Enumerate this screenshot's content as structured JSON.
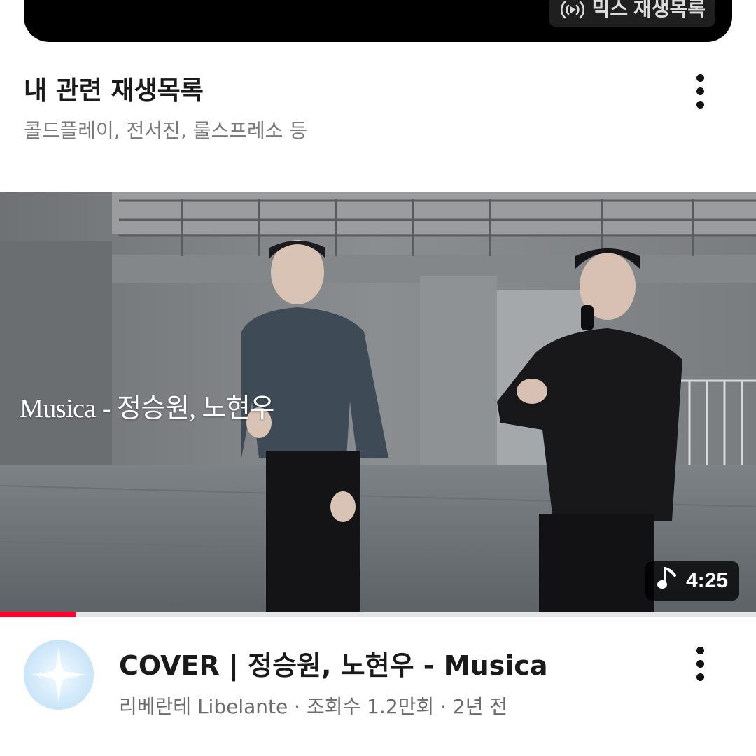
{
  "mix_card": {
    "badge_label": "믹스 재생목록",
    "badge_icon": "broadcast-icon"
  },
  "related": {
    "title": "내 관련 재생목록",
    "subtitle": "콜드플레이, 전서진, 룰스프레소 등",
    "menu_icon": "more-vert-icon"
  },
  "video": {
    "overlay_title": "Musica - 정승원, 노현우",
    "duration": "4:25",
    "duration_icon": "music-note-icon",
    "watch_progress": 0.1,
    "title": "COVER | 정승원, 노현우 - Musica",
    "channel": "리베란테 Libelante",
    "views": "조회수 1.2만회",
    "age": "2년 전",
    "avatar_text": "Libelante",
    "menu_icon": "more-vert-icon"
  },
  "colors": {
    "progress": "#ff0033",
    "card": "#000000",
    "text": "#0f0f0f",
    "subtext": "#6b6b6b"
  }
}
